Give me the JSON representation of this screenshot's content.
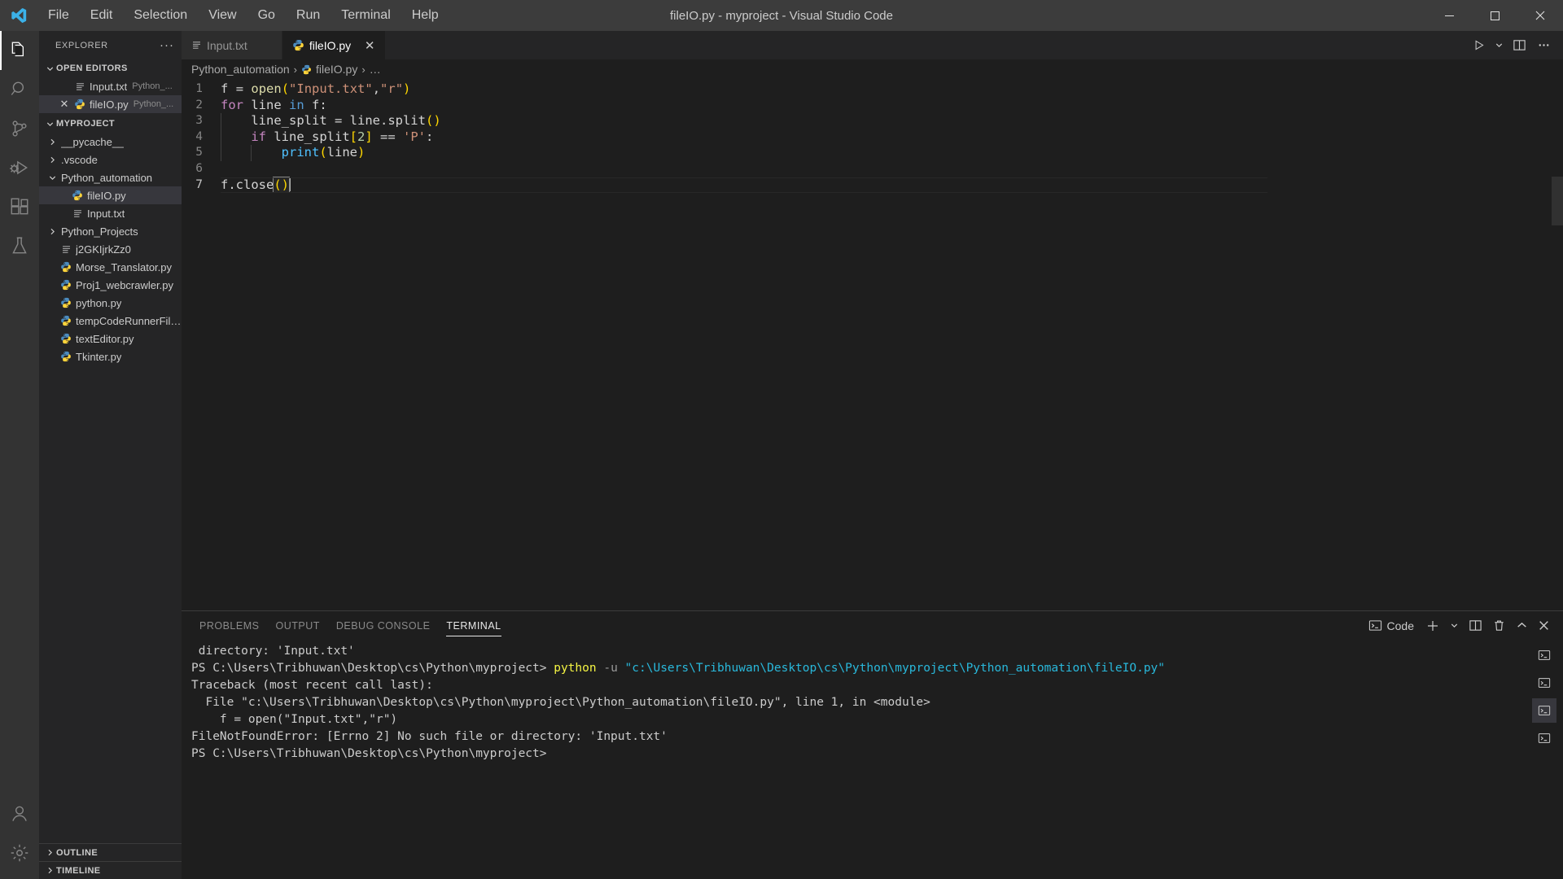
{
  "window": {
    "title": "fileIO.py - myproject - Visual Studio Code",
    "minimize_label": "─",
    "maximize_label": "☐",
    "close_label": "✕",
    "logo_name": "vscode-logo"
  },
  "menubar": {
    "items": [
      {
        "label": "File"
      },
      {
        "label": "Edit"
      },
      {
        "label": "Selection"
      },
      {
        "label": "View"
      },
      {
        "label": "Go"
      },
      {
        "label": "Run"
      },
      {
        "label": "Terminal"
      },
      {
        "label": "Help"
      }
    ]
  },
  "activitybar": {
    "items": [
      {
        "name": "explorer-icon",
        "label": "Explorer",
        "active": true
      },
      {
        "name": "search-icon",
        "label": "Search",
        "active": false
      },
      {
        "name": "source-control-icon",
        "label": "Source Control",
        "active": false
      },
      {
        "name": "run-and-debug-icon",
        "label": "Run and Debug",
        "active": false
      },
      {
        "name": "extensions-icon",
        "label": "Extensions",
        "active": false
      },
      {
        "name": "testing-icon",
        "label": "Testing",
        "active": false
      }
    ],
    "bottom": [
      {
        "name": "accounts-icon",
        "label": "Accounts"
      },
      {
        "name": "settings-gear-icon",
        "label": "Manage"
      }
    ]
  },
  "sidebar": {
    "title": "EXPLORER",
    "more_actions": "···",
    "open_editors": {
      "label": "OPEN EDITORS",
      "expanded": true,
      "items": [
        {
          "name": "Input.txt",
          "sub": "Python_...",
          "icon": "text-file-icon",
          "active": false,
          "dirty_close": ""
        },
        {
          "name": "fileIO.py",
          "sub": "Python_...",
          "icon": "python-file-icon",
          "active": true,
          "dirty_close": "✕"
        }
      ]
    },
    "project": {
      "label": "MYPROJECT",
      "expanded": true,
      "items": [
        {
          "name": "__pycache__",
          "icon": "folder-icon",
          "depth": 1,
          "chevron": "collapsed",
          "selected": false
        },
        {
          "name": ".vscode",
          "icon": "folder-icon",
          "depth": 1,
          "chevron": "collapsed",
          "selected": false
        },
        {
          "name": "Python_automation",
          "icon": "folder-icon",
          "depth": 1,
          "chevron": "expanded",
          "selected": false
        },
        {
          "name": "fileIO.py",
          "icon": "python-file-icon",
          "depth": 2,
          "chevron": "none",
          "selected": true
        },
        {
          "name": "Input.txt",
          "icon": "text-file-icon",
          "depth": 2,
          "chevron": "none",
          "selected": false
        },
        {
          "name": "Python_Projects",
          "icon": "folder-icon",
          "depth": 1,
          "chevron": "collapsed",
          "selected": false
        },
        {
          "name": "j2GKIjrkZz0",
          "icon": "text-file-icon",
          "depth": 1,
          "chevron": "none",
          "selected": false
        },
        {
          "name": "Morse_Translator.py",
          "icon": "python-file-icon",
          "depth": 1,
          "chevron": "none",
          "selected": false
        },
        {
          "name": "Proj1_webcrawler.py",
          "icon": "python-file-icon",
          "depth": 1,
          "chevron": "none",
          "selected": false
        },
        {
          "name": "python.py",
          "icon": "python-file-icon",
          "depth": 1,
          "chevron": "none",
          "selected": false
        },
        {
          "name": "tempCodeRunnerFile....",
          "icon": "python-file-icon",
          "depth": 1,
          "chevron": "none",
          "selected": false
        },
        {
          "name": "textEditor.py",
          "icon": "python-file-icon",
          "depth": 1,
          "chevron": "none",
          "selected": false
        },
        {
          "name": "Tkinter.py",
          "icon": "python-file-icon",
          "depth": 1,
          "chevron": "none",
          "selected": false
        }
      ]
    },
    "bottom_sections": [
      {
        "label": "OUTLINE"
      },
      {
        "label": "TIMELINE"
      }
    ]
  },
  "editor": {
    "tabs": [
      {
        "label": "Input.txt",
        "icon": "text-file-icon",
        "active": false,
        "close": "✕"
      },
      {
        "label": "fileIO.py",
        "icon": "python-file-icon",
        "active": true,
        "close": "✕"
      }
    ],
    "actions": [
      {
        "name": "run-python-file-button",
        "label": "Run"
      },
      {
        "name": "run-options-chevron-icon",
        "label": "Run options"
      },
      {
        "name": "split-editor-right-button",
        "label": "Split Editor Right"
      },
      {
        "name": "more-actions-button",
        "label": "..."
      }
    ],
    "breadcrumb": {
      "parts": [
        "Python_automation",
        "fileIO.py",
        "…"
      ],
      "separator": "›"
    },
    "active_line": 7,
    "code": {
      "lines": [
        {
          "no": "1",
          "tokens": [
            {
              "t": "f",
              "c": "plain"
            },
            {
              "t": " ",
              "c": "plain"
            },
            {
              "t": "=",
              "c": "op"
            },
            {
              "t": " ",
              "c": "plain"
            },
            {
              "t": "open",
              "c": "fn"
            },
            {
              "t": "(",
              "c": "paren"
            },
            {
              "t": "\"Input.txt\"",
              "c": "str"
            },
            {
              "t": ",",
              "c": "plain"
            },
            {
              "t": "\"r\"",
              "c": "str"
            },
            {
              "t": ")",
              "c": "paren"
            }
          ]
        },
        {
          "no": "2",
          "tokens": [
            {
              "t": "for",
              "c": "kw"
            },
            {
              "t": " line ",
              "c": "plain"
            },
            {
              "t": "in",
              "c": "kw2"
            },
            {
              "t": " f:",
              "c": "plain"
            }
          ]
        },
        {
          "no": "3",
          "tokens": [
            {
              "t": "    ",
              "c": "plain"
            },
            {
              "t": "line_split",
              "c": "plain"
            },
            {
              "t": " = ",
              "c": "op"
            },
            {
              "t": "line.split",
              "c": "plain"
            },
            {
              "t": "()",
              "c": "paren"
            }
          ]
        },
        {
          "no": "4",
          "tokens": [
            {
              "t": "    ",
              "c": "plain"
            },
            {
              "t": "if",
              "c": "kw"
            },
            {
              "t": " line_split",
              "c": "plain"
            },
            {
              "t": "[",
              "c": "paren"
            },
            {
              "t": "2",
              "c": "num"
            },
            {
              "t": "]",
              "c": "paren"
            },
            {
              "t": " == ",
              "c": "op"
            },
            {
              "t": "'P'",
              "c": "str"
            },
            {
              "t": ":",
              "c": "plain"
            }
          ]
        },
        {
          "no": "5",
          "tokens": [
            {
              "t": "        ",
              "c": "plain"
            },
            {
              "t": "print",
              "c": "fn2"
            },
            {
              "t": "(",
              "c": "paren"
            },
            {
              "t": "line",
              "c": "plain"
            },
            {
              "t": ")",
              "c": "paren"
            }
          ]
        },
        {
          "no": "6",
          "tokens": []
        },
        {
          "no": "7",
          "tokens": [
            {
              "t": "f.close",
              "c": "plain"
            },
            {
              "t": "()",
              "c": "paren",
              "match": true
            }
          ]
        }
      ]
    }
  },
  "panel": {
    "tabs": [
      {
        "label": "PROBLEMS",
        "active": false
      },
      {
        "label": "OUTPUT",
        "active": false
      },
      {
        "label": "DEBUG CONSOLE",
        "active": false
      },
      {
        "label": "TERMINAL",
        "active": true
      }
    ],
    "actions": {
      "shell_label": "Code",
      "shell_icon": "terminal-icon",
      "new_terminal": "+",
      "new_terminal_chevron": "⌄",
      "split_terminal": "split-terminal-icon",
      "kill_terminal": "trash-icon",
      "collapse": "⌃",
      "close": "✕"
    },
    "terminal": {
      "lines": [
        {
          "segments": [
            {
              "t": " directory: 'Input.txt'",
              "c": "t-white"
            }
          ]
        },
        {
          "segments": [
            {
              "t": "PS C:\\Users\\Tribhuwan\\Desktop\\cs\\Python\\myproject> ",
              "c": "t-white"
            },
            {
              "t": "python",
              "c": "t-yellow"
            },
            {
              "t": " ",
              "c": "t-white"
            },
            {
              "t": "-u",
              "c": "t-gray"
            },
            {
              "t": " ",
              "c": "t-white"
            },
            {
              "t": "\"c:\\Users\\Tribhuwan\\Desktop\\cs\\Python\\myproject\\Python_automation\\fileIO.py\"",
              "c": "t-cyan"
            }
          ]
        },
        {
          "segments": [
            {
              "t": "Traceback (most recent call last):",
              "c": "t-white"
            }
          ]
        },
        {
          "segments": [
            {
              "t": "  File \"c:\\Users\\Tribhuwan\\Desktop\\cs\\Python\\myproject\\Python_automation\\fileIO.py\", line 1, in <module>",
              "c": "t-white"
            }
          ]
        },
        {
          "segments": [
            {
              "t": "    f = open(\"Input.txt\",\"r\")",
              "c": "t-white"
            }
          ]
        },
        {
          "segments": [
            {
              "t": "FileNotFoundError: [Errno 2] No such file or directory: 'Input.txt'",
              "c": "t-white"
            }
          ]
        },
        {
          "segments": [
            {
              "t": "PS C:\\Users\\Tribhuwan\\Desktop\\cs\\Python\\myproject>",
              "c": "t-white"
            }
          ]
        }
      ],
      "instances": [
        {
          "name": "terminal-instance-1",
          "active": false
        },
        {
          "name": "terminal-instance-2",
          "active": false
        },
        {
          "name": "terminal-instance-3",
          "active": true
        },
        {
          "name": "terminal-instance-4",
          "active": false
        }
      ]
    }
  },
  "colors": {
    "titlebar_bg": "#3c3c3c",
    "activitybar_bg": "#333333",
    "sidebar_bg": "#252526",
    "editor_bg": "#1e1e1e",
    "accent_blue": "#0078d4",
    "string": "#ce9178",
    "keyword": "#c586c0",
    "function": "#dcdcaa",
    "terminal_yellow": "#f5f543",
    "terminal_cyan": "#29b8db"
  }
}
